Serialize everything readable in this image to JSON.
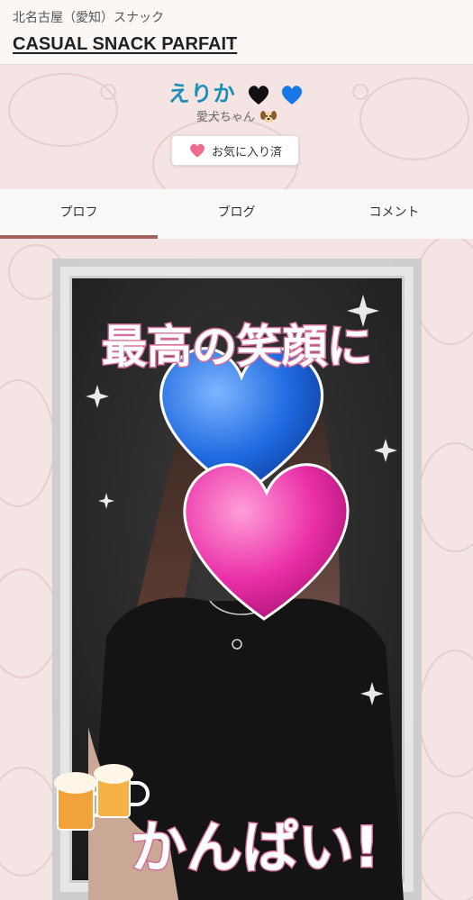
{
  "header": {
    "area_label": "北名古屋（愛知）スナック",
    "shop_name": "CASUAL SNACK PARFAIT"
  },
  "profile": {
    "name": "えりか",
    "name_emoji": [
      "black-heart-icon",
      "blue-heart-icon"
    ],
    "subtitle": "愛犬ちゃん",
    "subtitle_emoji": "dog-face-icon",
    "favorite_button": {
      "label": "お気に入り済",
      "icon": "pink-heart-icon"
    }
  },
  "tabs": [
    {
      "label": "プロフ",
      "active": true
    },
    {
      "label": "ブログ",
      "active": false
    },
    {
      "label": "コメント",
      "active": false
    }
  ],
  "photo": {
    "caption_top": "最高の笑顔に",
    "caption_bottom": "かんぱい!",
    "stickers": [
      "blue-heart-sticker",
      "pink-heart-sticker",
      "beer-mugs-sticker"
    ]
  },
  "colors": {
    "name": "#1d8fb5",
    "tab_indicator": "#a5625e",
    "background": "#f5e4e4"
  }
}
